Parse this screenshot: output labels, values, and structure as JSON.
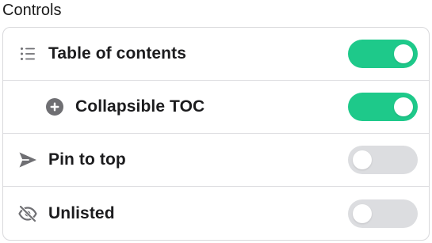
{
  "section": {
    "title": "Controls"
  },
  "colors": {
    "toggle_on": "#1ec98a",
    "toggle_off": "#dcdde0",
    "icon": "#6f6f73"
  },
  "controls": [
    {
      "label": "Table of contents",
      "icon": "list-icon",
      "enabled": true
    },
    {
      "label": "Collapsible TOC",
      "icon": "plus-circle-icon",
      "enabled": true
    },
    {
      "label": "Pin to top",
      "icon": "send-icon",
      "enabled": false
    },
    {
      "label": "Unlisted",
      "icon": "eye-off-icon",
      "enabled": false
    }
  ]
}
